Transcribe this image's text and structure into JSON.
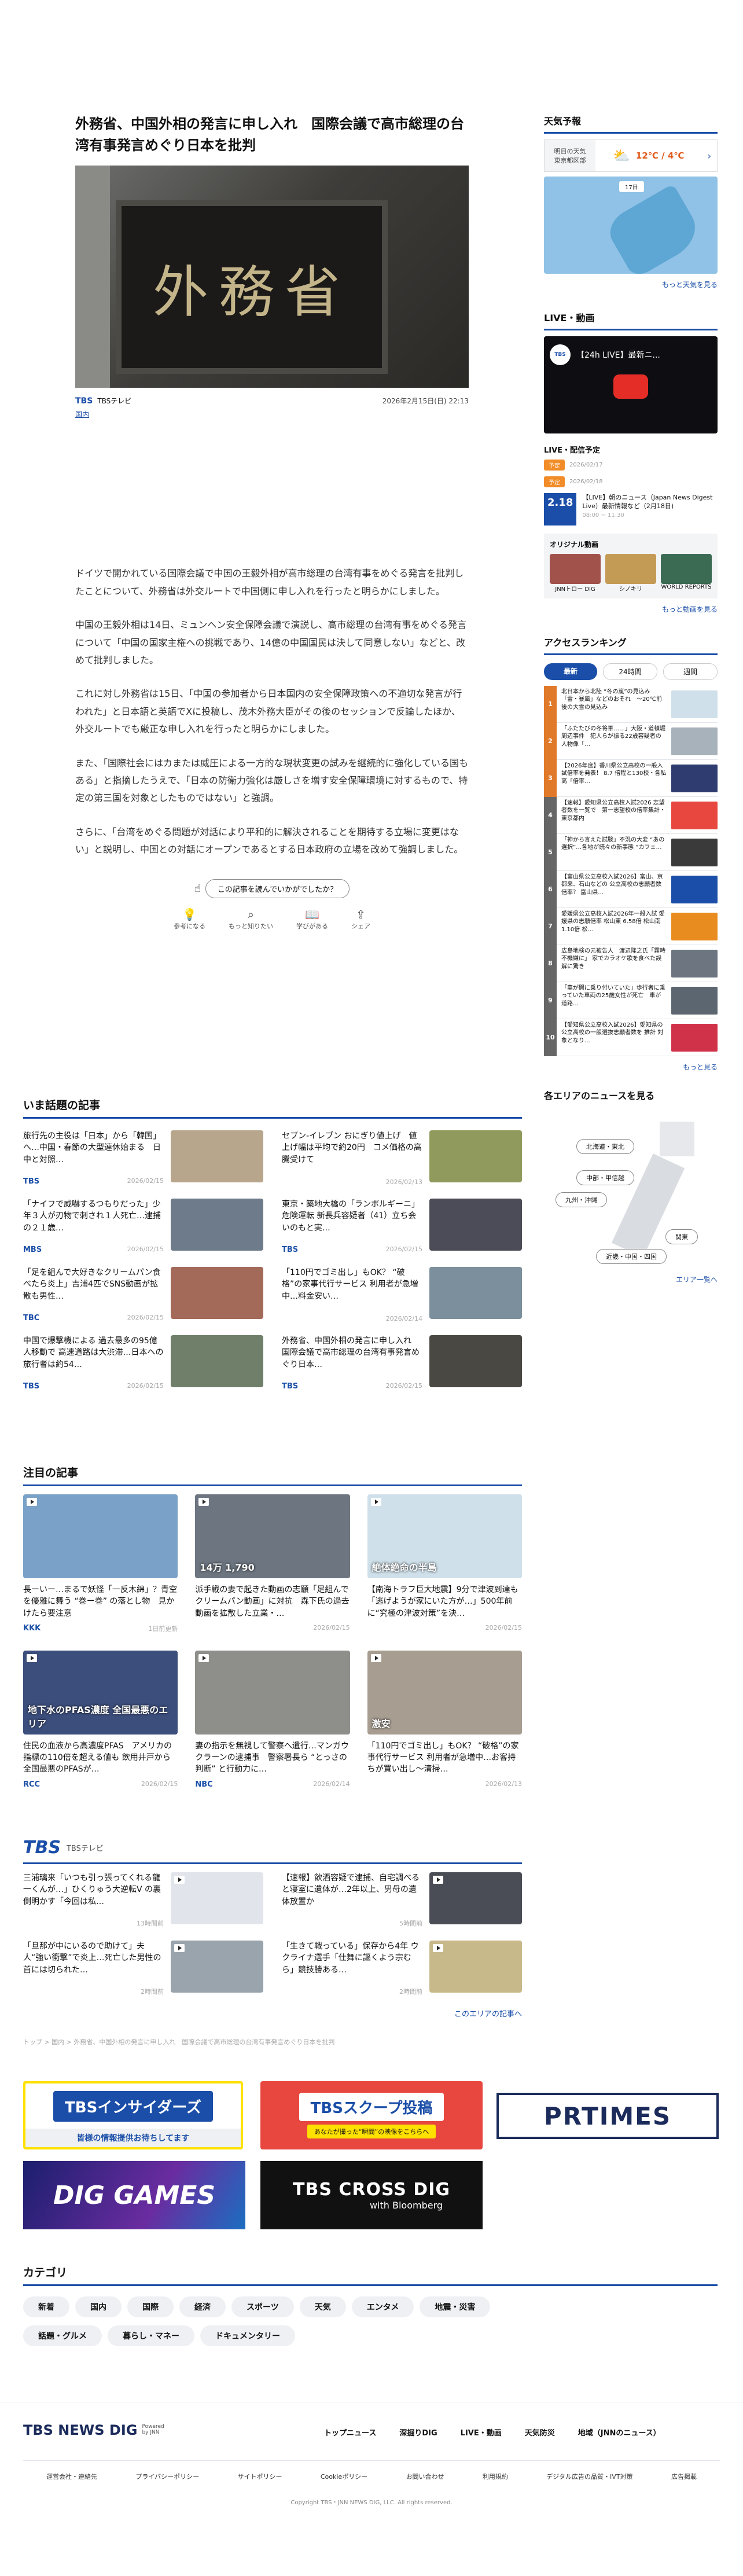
{
  "article": {
    "title": "外務省、中国外相の発言に申し入れ　国際会議で高市総理の台湾有事発言めぐり日本を批判",
    "photo_text": "外務省",
    "source": "TBSテレビ",
    "date": "2026年2月15日(日) 22:13",
    "category": "国内",
    "paragraphs": [
      "ドイツで開かれている国際会議で中国の王毅外相が高市総理の台湾有事をめぐる発言を批判したことについて、外務省は外交ルートで中国側に申し入れを行ったと明らかにしました。",
      "中国の王毅外相は14日、ミュンヘン安全保障会議で演説し、高市総理の台湾有事をめぐる発言について「中国の国家主権への挑戦であり、14億の中国国民は決して同意しない」などと、改めて批判しました。",
      "これに対し外務省は15日、「中国の参加者から日本国内の安全保障政策への不適切な発言が行われた」と日本語と英語でXに投稿し、茂木外務大臣がその後のセッションで反論したほか、外交ルートでも厳正な申し入れを行ったと明らかにしました。",
      "また、「国際社会にはカまたは威圧による一方的な現状変更の試みを継続的に強化している国もある」と指摘したうえで、「日本の防衛力強化は厳しさを増す安全保障環境に対するもので、特定の第三国を対象としたものではない」と強調。",
      "さらに、「台湾をめぐる問題が対話により平和的に解決されることを期待する立場に変更はない」と説明し、中国との対話にオープンであるとする日本政府の立場を改めて強調しました。"
    ],
    "feedback_question": "この記事を読んでいかがでしたか？",
    "reactions": [
      "参考になる",
      "もっと知りたい",
      "学びがある",
      "シェア"
    ]
  },
  "sidebar": {
    "weather_title": "天気予報",
    "weather_label1": "明日の天気",
    "weather_label2": "東京都区部",
    "weather_temp": "12℃ / 4℃",
    "weather_more": "もっと天気を見る",
    "live_title": "LIVE・動画",
    "live_video_title": "【24h LIVE】最新ニ...",
    "schedule_title": "LIVE・配信予定",
    "schedule": [
      {
        "badge": "予定",
        "date": "2026/02/17"
      },
      {
        "badge": "予定",
        "date": "2026/02/18"
      }
    ],
    "live_item_title": "【LIVE】朝のニュース（Japan News Digest Live）最新情報など（2月18日)",
    "live_item_time": "08:00 ~ 11:30",
    "live_item_date": "2.18",
    "original_title": "オリジナル動画",
    "originals": [
      "JNNトロー DIG",
      "シノキリ",
      "WORLD REPORTS"
    ],
    "video_more": "もっと動画を見る",
    "ranking_title": "アクセスランキング",
    "ranking_tabs": [
      "最新",
      "24時間",
      "週間"
    ],
    "ranking": [
      "北日本から北陸 “冬の嵐”の見込み「雷・暴風」などのおそれ　～20℃前後の大雪の見込み",
      "「ふたたびの冬将軍……」大阪・道頓堀周辺事件　犯人らが振る22歳容疑者の人物像「…",
      "【2026年度】香川県公立高校の一般入試倍率を発表！ 8.7 倍程と130校・各私高「倍率…",
      "【速報】愛知県公立高校入試2026 志望者数を一覧で　第一志望校の倍率集計・東京都内",
      "「神から言えた試験」不況の大変 “あの選択”…各地が続々の新事態 “カフェ…",
      "【富山県公立高校入試2026】富山、京都来、石山などの 公立高校の志願者数倍率？ 富山県…",
      "愛媛県公立高校入試2026年一般入試 愛媛県の志願倍率 松山東 6.58倍 松山南1.10倍 松…",
      "広島地検の元被告人　渡辺隆之氏「霧時不機嫌に」 家でカラオケ歌を食べた誤解に驚き",
      "「車が開に乗り付いていた」歩行者に乗っていた車両の25歳女性が死亡　車が道路…",
      "【愛知県公立高校入試2026】愛知県の公立高校の一般選抜志願者数を 推計 対象となり…"
    ],
    "ranking_more": "もっと見る",
    "area_title": "各エリアのニュースを見る",
    "areas": [
      "北海道・東北",
      "中部・甲信越",
      "九州・沖縄",
      "関東",
      "近畿・中国・四国"
    ],
    "area_more": "エリア一覧へ"
  },
  "trending": {
    "title": "いま話題の記事",
    "items": [
      {
        "text": "旅行先の主役は「日本」から「韓国」へ…中国・春節の大型連休始まる　日中と対照…",
        "src": "TBS",
        "date": "2026/02/15"
      },
      {
        "text": "セブン-イレブン おにぎり値上げ　値上げ幅は平均で約20円　コメ価格の高騰受けて",
        "src": "",
        "date": "2026/02/13"
      },
      {
        "text": "「ナイフで威嚇するつもりだった」少年３人が刃物で刺され１人死亡…逮捕の２１歳…",
        "src": "MBS",
        "date": "2026/02/15"
      },
      {
        "text": "東京・築地大橋の「ランボルギーニ」危険運転 新長兵容疑者（41）立ち会いのもと実…",
        "src": "TBS",
        "date": "2026/02/15"
      },
      {
        "text": "「足を組んで大好きなクリームパン食べたら炎上」吉浦4匹でSNS動画が拡散も男性…",
        "src": "TBC",
        "date": "2026/02/15"
      },
      {
        "text": "「110円でゴミ出し」もOK？ “破格”の家事代行サービス 利用者が急増中…料金安い…",
        "src": "",
        "date": "2026/02/14"
      },
      {
        "text": "中国で爆撃機による 過去最多の95億人移動で 高速道路は大渋滞…日本への旅行者は約54…",
        "src": "TBS",
        "date": "2026/02/15"
      },
      {
        "text": "外務省、中国外相の発言に申し入れ　国際会議で高市総理の台湾有事発言めぐり日本…",
        "src": "TBS",
        "date": "2026/02/15"
      }
    ]
  },
  "featured": {
    "title": "注目の記事",
    "items": [
      {
        "text": "長ーいー…まるで妖怪「一反木綿」？青空を優雅に舞う “巻ー巻” の落とし物　見かけたら要注意",
        "src": "KKK",
        "date": "1日前更新",
        "img": ""
      },
      {
        "text": "派手戦の妻で起きた動画の志願「足組んでクリームパン動画」に対抗　森下氏の過去動画を拡散した立業・…",
        "src": "",
        "date": "2026/02/15",
        "img": "14万 1,790"
      },
      {
        "text": "【南海トラフ巨大地震】9分で津波到達も「逃げようが家にいた方が…」500年前に“究極の津波対策”を決…",
        "src": "",
        "date": "2026/02/15",
        "img": "絶体絶命の半島"
      },
      {
        "text": "住民の血液から高濃度PFAS　アメリカの指標の110倍を超える値も 飲用井戸から全国最悪のPFASが…",
        "src": "RCC",
        "date": "2026/02/15",
        "img": "地下水のPFAS濃度 全国最悪のエリア"
      },
      {
        "text": "妻の指示を無視して警察へ遺行…マンガウクラーンの逮捕事　警察署長ら “とっさの判断” と行動力に…",
        "src": "NBC",
        "date": "2026/02/14",
        "img": ""
      },
      {
        "text": "「110円でゴミ出し」もOK？ “破格”の家事代行サービス 利用者が急増中…お客持ちが買い出し〜清掃…",
        "src": "",
        "date": "2026/02/13",
        "img": "激安"
      }
    ]
  },
  "tbs": {
    "title": "TBSテレビ",
    "items": [
      {
        "text": "三浦璃来「いつも引っ張ってくれる龍一くんが…」ひくりゅう大逆転V の裏側明かす「今回は私…",
        "date": "13時間前"
      },
      {
        "text": "【速報】飲酒容疑で逮捕、自宅調べると寝室に遺体が…2年以上、男母の遺体放置か",
        "date": "5時間前"
      },
      {
        "text": "「旦那が中にいるので助けて」夫人“強い衝撃”で炎上…死亡した男性の首には切られた…",
        "date": "2時間前"
      },
      {
        "text": "「生きて戦っている」保存から4年 ウクライナ選手「仕舞に謳くよう宗むら」競技勝ある…",
        "date": "2時間前"
      }
    ],
    "more": "このエリアの記事へ"
  },
  "breadcrumb": "トップ > 国内 > 外務省、中国外相の発言に申し入れ　国際会議で高市総理の台湾有事発言めぐり日本を批判",
  "banners": {
    "insiders": "TBSインサイダーズ",
    "insiders_sub": "皆様の情報提供お待ちしてます",
    "scoop": "TBSスクープ投稿",
    "scoop_sub": "あなたが撮った“瞬間”の映像をこちらへ",
    "prtimes": "PRTIMES",
    "dig_games": "DIG GAMES",
    "cross_dig": "TBS CROSS DIG",
    "cross_dig_sub": "with Bloomberg"
  },
  "categories": {
    "title": "カテゴリ",
    "items": [
      "新着",
      "国内",
      "国際",
      "経済",
      "スポーツ",
      "天気",
      "エンタメ",
      "地震・災害",
      "話題・グルメ",
      "暮らし・マネー",
      "ドキュメンタリー"
    ]
  },
  "footer": {
    "logo": "TBS NEWS DIG",
    "logo_sub": "Powered by JNN",
    "nav": [
      "トップニュース",
      "深掘りDIG",
      "LIVE・動画",
      "天気防災",
      "地域（JNNのニュース）"
    ],
    "links": [
      "運営会社・連絡先",
      "プライバシーポリシー",
      "サイトポリシー",
      "Cookieポリシー",
      "お問い合わせ",
      "利用規約",
      "デジタル広告の品質・IVT対策",
      "広告掲載"
    ],
    "copyright": "Copyright TBS・JNN NEWS DIG, LLC. All rights reserved."
  }
}
